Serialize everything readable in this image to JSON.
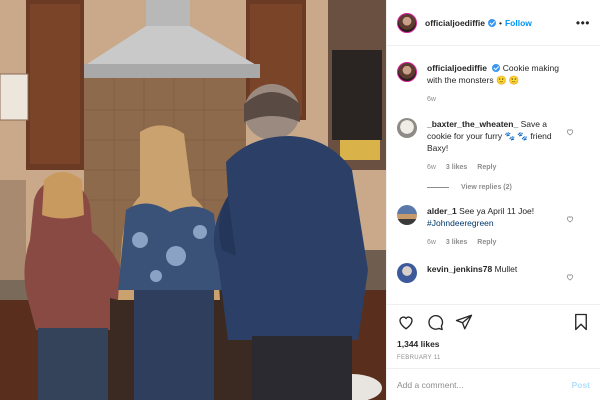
{
  "post": {
    "username": "officialjoediffie",
    "follow_label": "Follow",
    "caption_user": "officialjoediffie",
    "caption_text": "Cookie making with the monsters 🙂 🙂",
    "caption_age": "6w",
    "comments": [
      {
        "user": "_baxter_the_wheaten_",
        "text": "Save a cookie for your furry 🐾 🐾 friend Baxy!",
        "age": "6w",
        "likes": "3 likes",
        "reply_label": "Reply",
        "view_replies": "View replies (2)"
      },
      {
        "user": "alder_1",
        "text": "See ya April 11 Joe!",
        "hashtag": "#Johndeeregreen",
        "age": "6w",
        "likes": "3 likes",
        "reply_label": "Reply"
      },
      {
        "user": "kevin_jenkins78",
        "text": "Mullet"
      }
    ],
    "like_count": "1,344 likes",
    "date": "FEBRUARY 11",
    "comment_placeholder": "Add a comment...",
    "post_label": "Post"
  },
  "icons": [
    "heart-icon",
    "comment-icon",
    "share-icon",
    "bookmark-icon",
    "more-icon",
    "verified-badge-icon"
  ],
  "colors": {
    "link": "#0095f6",
    "muted": "#8e8e8e",
    "post_disabled": "#b2dffc",
    "hashtag": "#00376b"
  }
}
